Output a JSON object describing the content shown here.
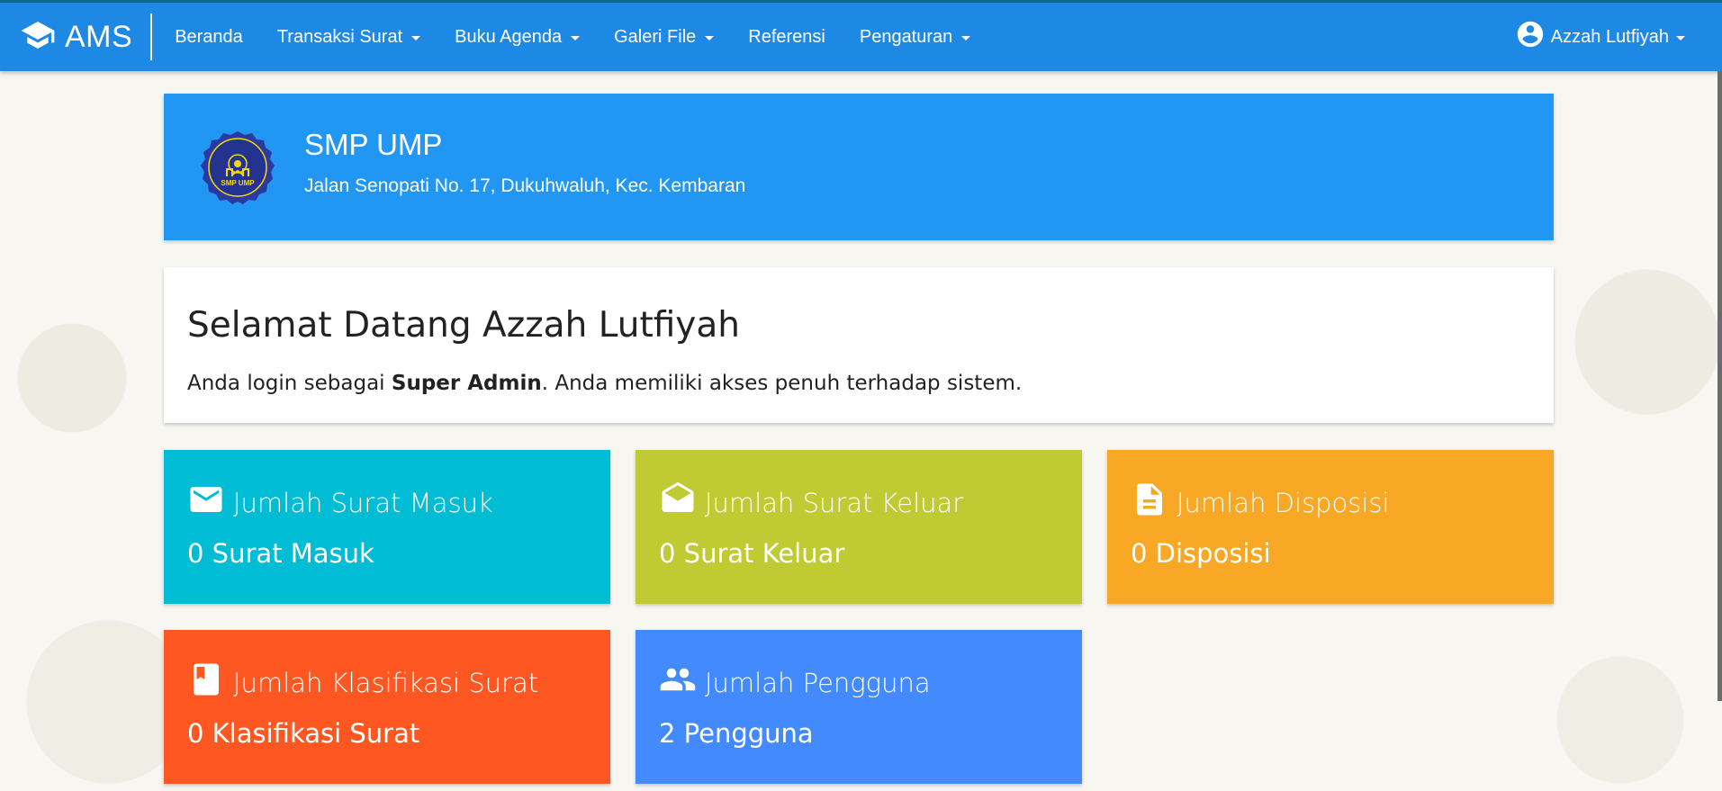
{
  "navbar": {
    "brand": "AMS",
    "items": [
      {
        "label": "Beranda",
        "dropdown": false
      },
      {
        "label": "Transaksi Surat",
        "dropdown": true
      },
      {
        "label": "Buku Agenda",
        "dropdown": true
      },
      {
        "label": "Galeri File",
        "dropdown": true
      },
      {
        "label": "Referensi",
        "dropdown": false
      },
      {
        "label": "Pengaturan",
        "dropdown": true
      }
    ],
    "user": "Azzah Lutfiyah"
  },
  "school": {
    "name": "SMP UMP",
    "address": "Jalan Senopati No. 17, Dukuhwaluh, Kec. Kembaran",
    "logo_text": "SMP UMP"
  },
  "welcome": {
    "title": "Selamat Datang Azzah Lutfiyah",
    "text_prefix": "Anda login sebagai ",
    "role": "Super Admin",
    "text_suffix": ". Anda memiliki akses penuh terhadap sistem."
  },
  "stats": [
    {
      "title": "Jumlah Surat Masuk",
      "value": "0 Surat Masuk",
      "icon": "mail-icon",
      "color": "#00bcd4"
    },
    {
      "title": "Jumlah Surat Keluar",
      "value": "0 Surat Keluar",
      "icon": "drafts-icon",
      "color": "#c0ca33"
    },
    {
      "title": "Jumlah Disposisi",
      "value": "0 Disposisi",
      "icon": "description-icon",
      "color": "#f9a825"
    },
    {
      "title": "Jumlah Klasifikasi Surat",
      "value": "0 Klasifikasi Surat",
      "icon": "bookmark-book-icon",
      "color": "#ff5722"
    },
    {
      "title": "Jumlah Pengguna",
      "value": "2 Pengguna",
      "icon": "people-icon",
      "color": "#448aff"
    }
  ],
  "colors": {
    "navbar": "#1e88e5",
    "header_card": "#2196f3"
  }
}
